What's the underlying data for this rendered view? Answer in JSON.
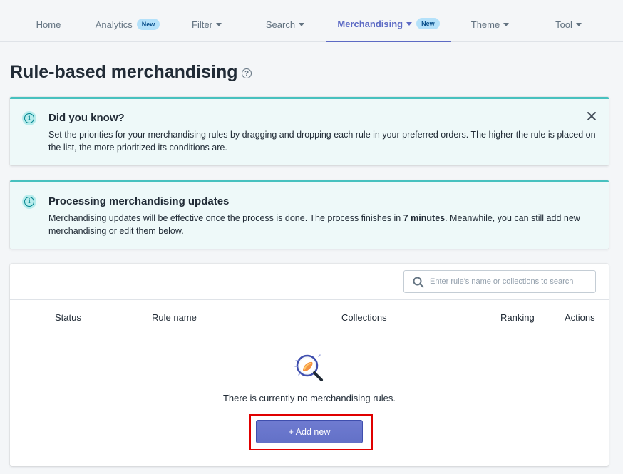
{
  "nav": {
    "items": [
      {
        "label": "Home"
      },
      {
        "label": "Analytics",
        "badge": "New"
      },
      {
        "label": "Filter"
      },
      {
        "label": "Search"
      },
      {
        "label": "Merchandising",
        "badge": "New"
      },
      {
        "label": "Theme"
      },
      {
        "label": "Tool"
      }
    ],
    "active": "Merchandising"
  },
  "page": {
    "title": "Rule-based merchandising",
    "help_symbol": "?"
  },
  "banners": [
    {
      "title": "Did you know?",
      "text": "Set the priorities for your merchandising rules by dragging and dropping each rule in your preferred orders. The higher the rule is placed on the list, the more prioritized its conditions are."
    },
    {
      "title": "Processing merchandising updates",
      "text_before": "Merchandising updates will be effective once the process is done. The process finishes in ",
      "text_bold": "7 minutes",
      "text_after": ". Meanwhile, you can still add new merchandising or edit them below."
    }
  ],
  "table": {
    "search_placeholder": "Enter rule's name or collections to search",
    "columns": [
      "Status",
      "Rule name",
      "Collections",
      "Ranking",
      "Actions"
    ],
    "empty_text": "There is currently no merchandising rules.",
    "add_button": "+ Add new"
  },
  "colors": {
    "accent": "#5c6ac4",
    "banner_bg": "#eef9f9",
    "banner_border": "#47c1bf",
    "highlight": "#e00000"
  },
  "icons": {
    "help": "question-circle-icon",
    "info": "info-circle-icon",
    "close": "close-icon",
    "search": "search-icon",
    "empty": "magnifier-illustration"
  }
}
